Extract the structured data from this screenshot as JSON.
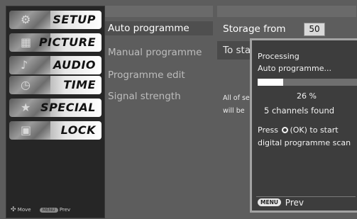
{
  "sidebar": {
    "items": [
      {
        "label": "SETUP",
        "icon": "setup-icon"
      },
      {
        "label": "PICTURE",
        "icon": "picture-icon"
      },
      {
        "label": "AUDIO",
        "icon": "audio-icon"
      },
      {
        "label": "TIME",
        "icon": "time-icon"
      },
      {
        "label": "SPECIAL",
        "icon": "special-icon"
      },
      {
        "label": "LOCK",
        "icon": "lock-icon"
      }
    ],
    "help_move": "Move",
    "help_key": "MENU",
    "help_prev": "Prev"
  },
  "menu": {
    "items": [
      {
        "label": "Auto programme"
      },
      {
        "label": "Manual programme"
      },
      {
        "label": "Programme edit"
      },
      {
        "label": "Signal strength"
      }
    ]
  },
  "right": {
    "storage_label": "Storage from",
    "storage_value": "50",
    "start_label": "To start",
    "note_line1": "All of se",
    "note_line2": "will be"
  },
  "popup": {
    "title": "Processing",
    "subtitle": "Auto programme...",
    "progress_percent": 26,
    "percent_text": "26 %",
    "found_text": "5 channels found",
    "press_prefix": "Press",
    "press_suffix": "(OK) to start",
    "press_line2": "digital programme scan",
    "footer_key": "MENU",
    "footer_label": "Prev"
  },
  "colors": {
    "background": "#5d5d5d",
    "sidebar": "#262626",
    "popup": "#3d3d3d",
    "popup_border": "#a3a3a3"
  }
}
